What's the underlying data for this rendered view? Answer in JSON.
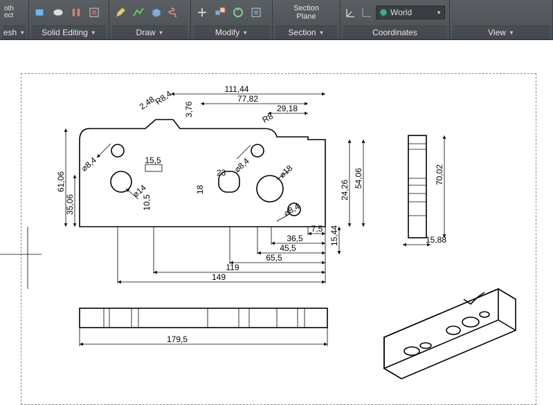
{
  "ribbon": {
    "panels": [
      {
        "id": "mesh",
        "label_partial": "esh",
        "dropdown": true
      },
      {
        "id": "solid-editing",
        "label": "Solid Editing",
        "dropdown": true
      },
      {
        "id": "draw",
        "label": "Draw",
        "dropdown": true
      },
      {
        "id": "modify",
        "label": "Modify",
        "dropdown": true
      },
      {
        "id": "section",
        "label": "Section",
        "dropdown": true,
        "big_button": "Section\nPlane"
      },
      {
        "id": "coordinates",
        "label": "Coordinates",
        "combo": "World"
      },
      {
        "id": "view",
        "label": "View",
        "dropdown": true
      }
    ],
    "partial_label_oth": "oth",
    "partial_label_ect": "ect"
  },
  "drawing": {
    "dimensions": {
      "d_111_44": "111,44",
      "d_77_82": "77,82",
      "d_29_18": "29,18",
      "d_2_48": "2,48",
      "d_3_76": "3,76",
      "d_R8_4": "R8,4",
      "d_R8": "R8",
      "d_phi_8_4_a": "⌀8,4",
      "d_15_5": "15,5",
      "d_23": "23",
      "d_phi_8_4_b": "⌀8,4",
      "d_phi_18": "⌀18",
      "d_18": "18",
      "d_10_5": "10,5",
      "d_61_06": "61,06",
      "d_35_06": "35,06",
      "d_phi_14": "⌀14",
      "d_phi_8_4_c": "⌀8,4",
      "d_7_5": "7,5",
      "d_36_5": "36,5",
      "d_45_5": "45,5",
      "d_65_5": "65,5",
      "d_119": "119",
      "d_149": "149",
      "d_15_44": "15,44",
      "d_24_26": "24,26",
      "d_54_06": "54,06",
      "d_70_02": "70,02",
      "d_15_88": "15,88",
      "d_179_5": "179,5"
    }
  }
}
